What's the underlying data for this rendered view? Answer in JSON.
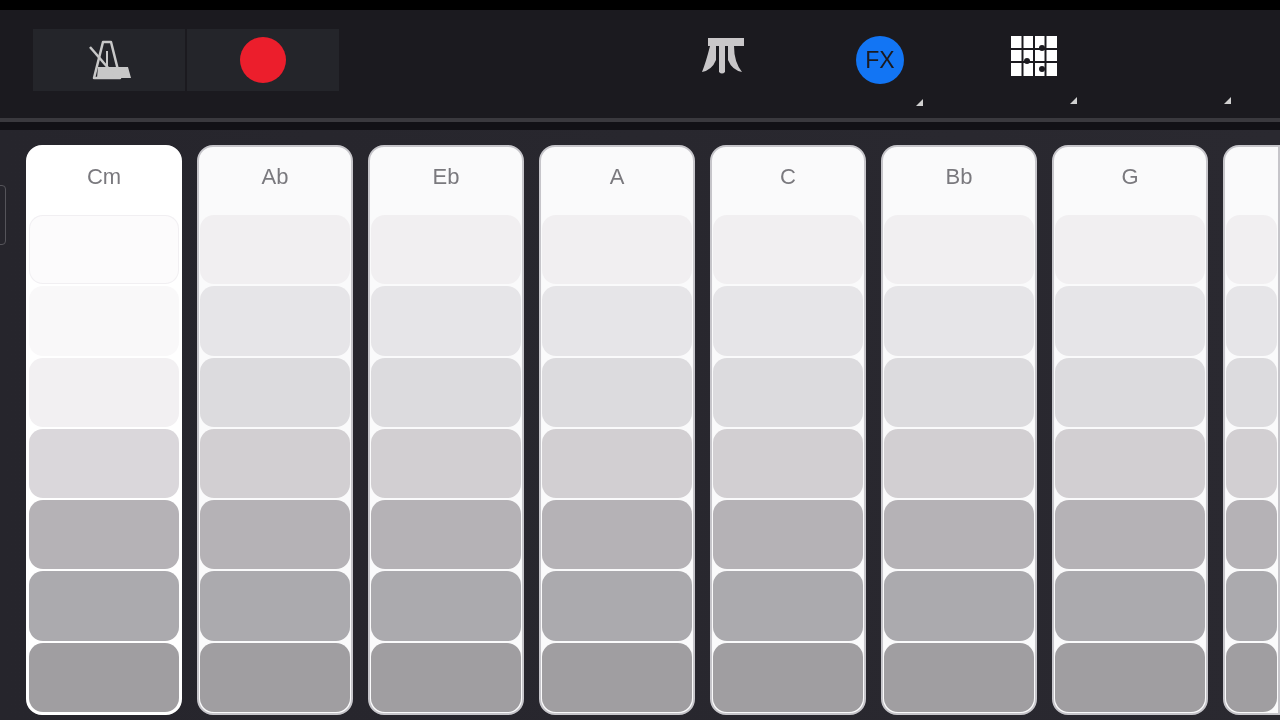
{
  "toolbar": {
    "left_buttons": [
      {
        "kind": "metronome",
        "on": false
      },
      {
        "kind": "record"
      }
    ],
    "right_buttons": [
      {
        "kind": "keys",
        "menu": false
      },
      {
        "kind": "fx",
        "label": "FX",
        "on": true,
        "menu": true
      },
      {
        "kind": "grid",
        "menu": true
      },
      {
        "kind": "hidden",
        "menu": true
      }
    ]
  },
  "chord_strips": [
    {
      "label": "Cm",
      "selected": true
    },
    {
      "label": "Ab",
      "selected": false
    },
    {
      "label": "Eb",
      "selected": false
    },
    {
      "label": "A",
      "selected": false
    },
    {
      "label": "C",
      "selected": false
    },
    {
      "label": "Bb",
      "selected": false
    },
    {
      "label": "G",
      "selected": false
    },
    {
      "selected": false
    }
  ]
}
